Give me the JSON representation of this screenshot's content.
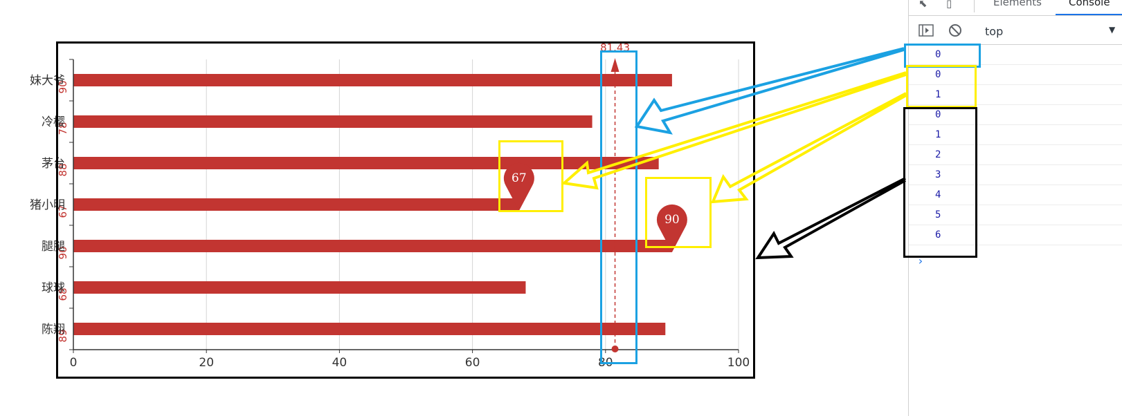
{
  "chart_data": {
    "type": "bar",
    "orientation": "horizontal",
    "categories": [
      "妹大爷",
      "冷樱",
      "茅台",
      "猪小明",
      "腿腿",
      "球球",
      "陈翔"
    ],
    "values": [
      90,
      78,
      88,
      67,
      90,
      68,
      89
    ],
    "value_labels": [
      "90",
      "78",
      "88",
      "67",
      "90",
      "68",
      "89"
    ],
    "xlim": [
      0,
      100
    ],
    "xticks": [
      "0",
      "20",
      "40",
      "60",
      "80",
      "100"
    ],
    "grid": true,
    "bar_color": "#c23531",
    "mark_points": [
      {
        "value": 67,
        "label": "67",
        "category": "猪小明"
      },
      {
        "value": 90,
        "label": "90",
        "category": "腿腿"
      }
    ],
    "mark_line": {
      "value": 81.43,
      "label": "81.43",
      "type": "average"
    }
  },
  "devtools": {
    "tabs": [
      "Elements",
      "Console"
    ],
    "active_tab": "Console",
    "icons": [
      "inspect-icon",
      "device-toggle-icon",
      "sidebar-toggle-icon",
      "clear-console-icon"
    ],
    "context": "top",
    "console_lines": [
      "0",
      "0",
      "1",
      "0",
      "1",
      "2",
      "3",
      "4",
      "5",
      "6"
    ]
  },
  "annotation_colors": {
    "blue": "#1ba1e2",
    "yellow": "#ffef00",
    "black": "#000000"
  }
}
